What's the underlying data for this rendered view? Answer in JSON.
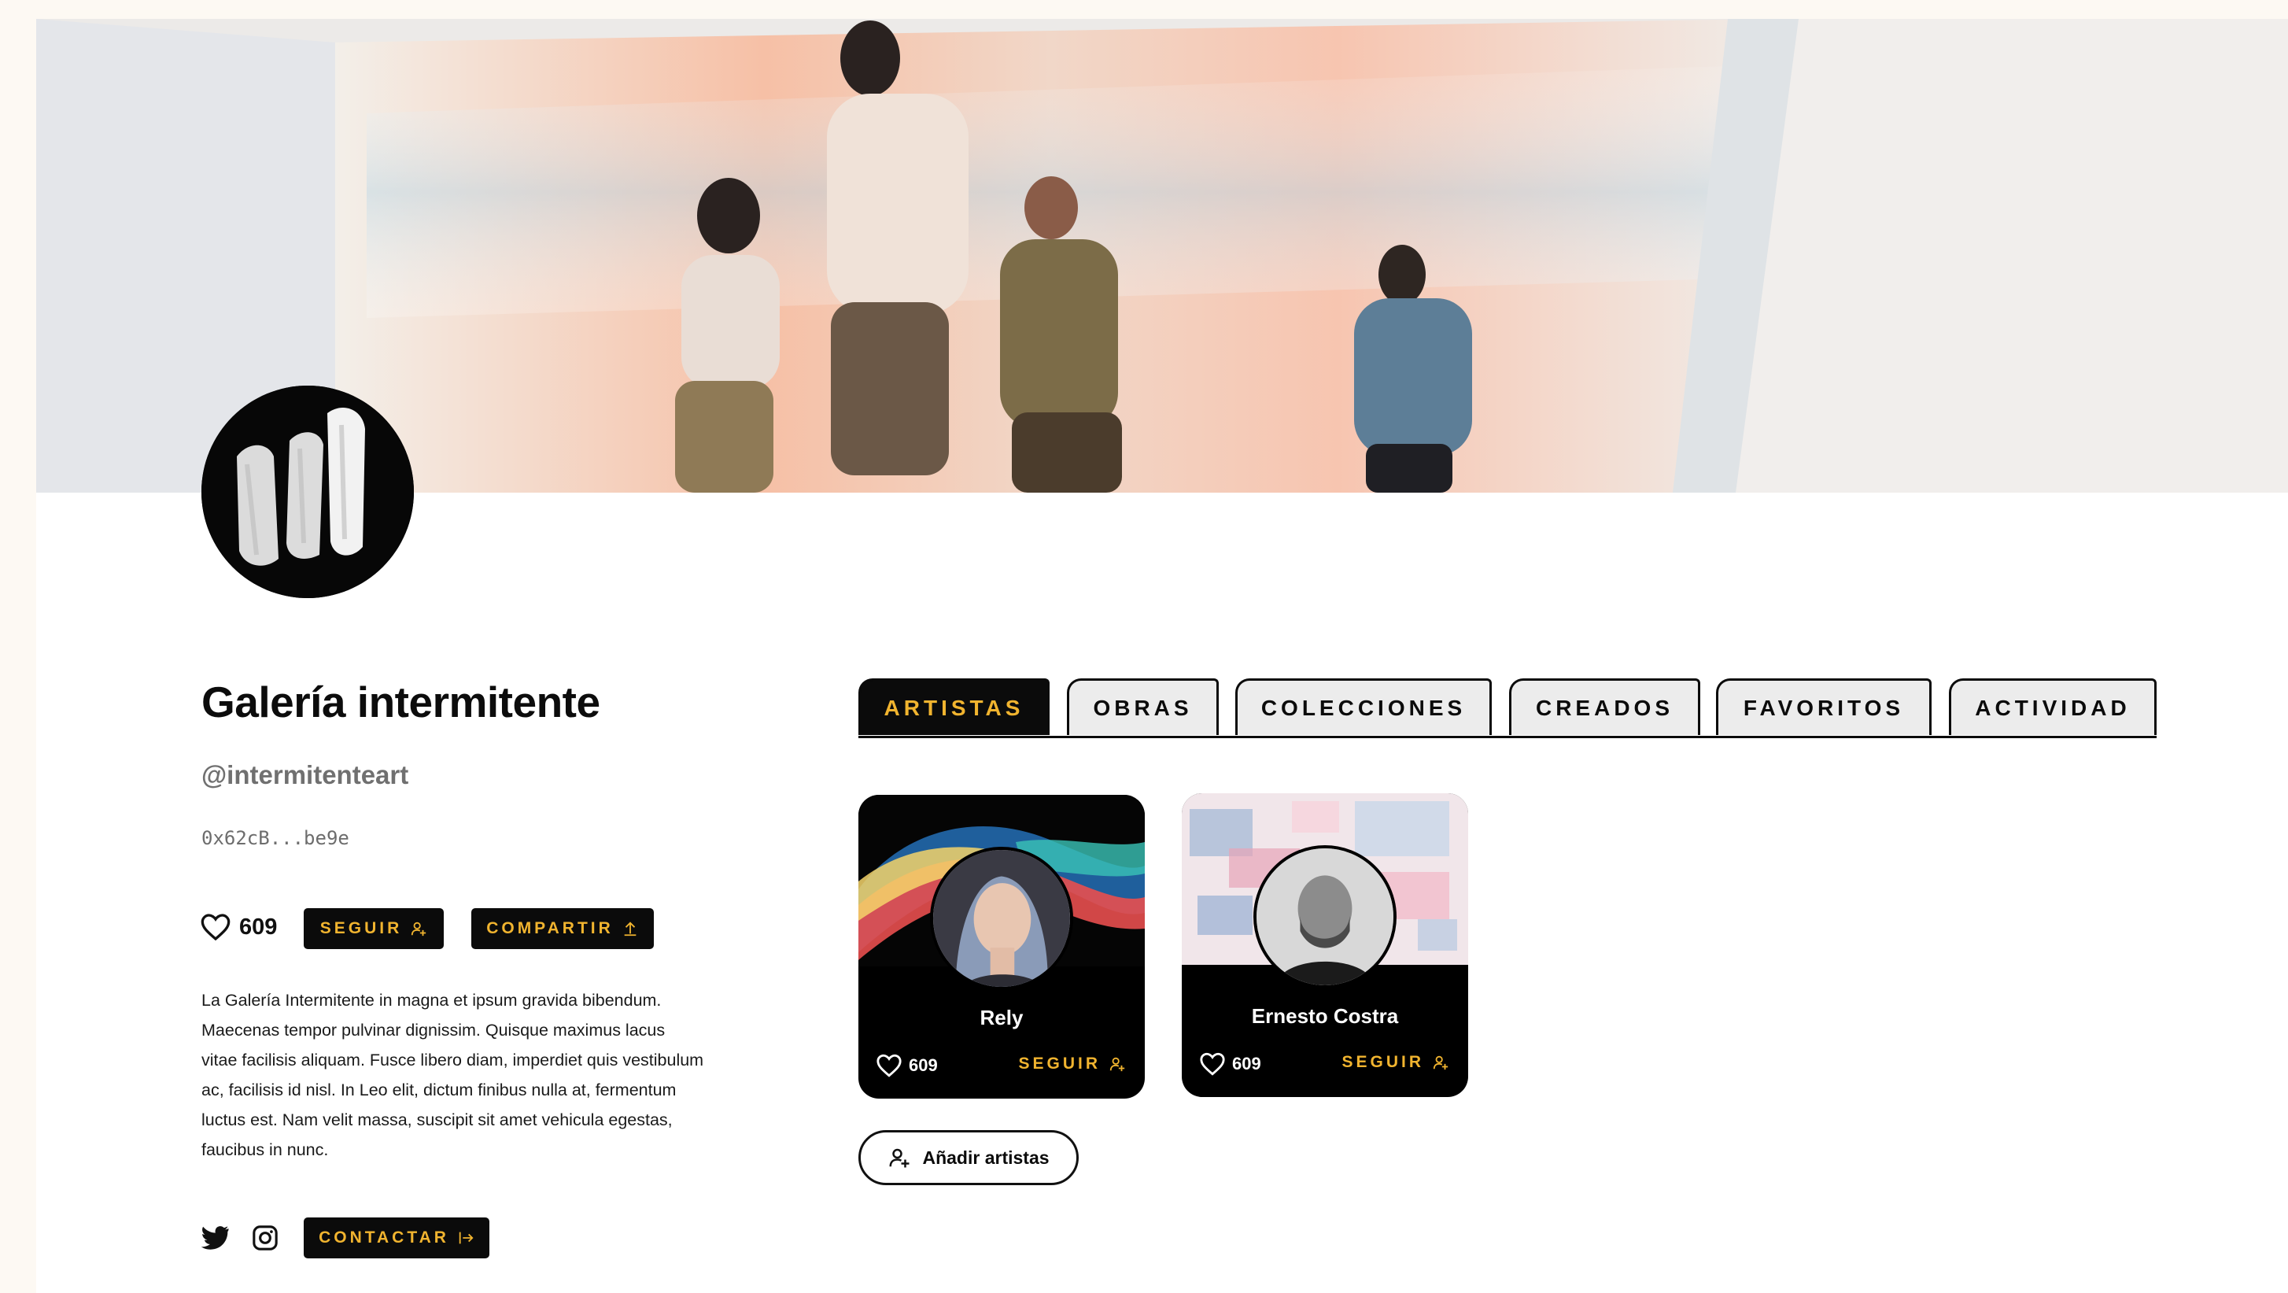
{
  "profile": {
    "name": "Galería intermitente",
    "handle": "@intermitenteart",
    "wallet": "0x62cB...be9e",
    "likes": "609",
    "follow_label": "SEGUIR",
    "share_label": "COMPARTIR",
    "contact_label": "CONTACTAR",
    "bio": "La Galería Intermitente in magna et ipsum gravida bibendum. Maecenas tempor pulvinar dignissim. Quisque maximus lacus vitae facilisis aliquam. Fusce libero diam, imperdiet quis vestibulum ac, facilisis id nisl. In Leo elit, dictum finibus nulla at, fermentum luctus est. Nam velit massa, suscipit sit amet vehicula egestas, faucibus in nunc."
  },
  "social": {
    "twitter_icon": "twitter-icon",
    "instagram_icon": "instagram-icon"
  },
  "tabs": [
    {
      "label": "ARTISTAS",
      "active": true
    },
    {
      "label": "OBRAS",
      "active": false
    },
    {
      "label": "COLECCIONES",
      "active": false
    },
    {
      "label": "CREADOS",
      "active": false
    },
    {
      "label": "FAVORITOS",
      "active": false
    },
    {
      "label": "ACTIVIDAD",
      "active": false
    }
  ],
  "artists": [
    {
      "name": "Rely",
      "likes": "609",
      "follow_label": "SEGUIR"
    },
    {
      "name": "Ernesto Costra",
      "likes": "609",
      "follow_label": "SEGUIR"
    }
  ],
  "add_artists_label": "Añadir artistas",
  "colors": {
    "accent": "#f1b42f",
    "dark": "#0b0b0b",
    "tab_inactive_bg": "#ececec",
    "page_bg": "#fdf9f3"
  }
}
